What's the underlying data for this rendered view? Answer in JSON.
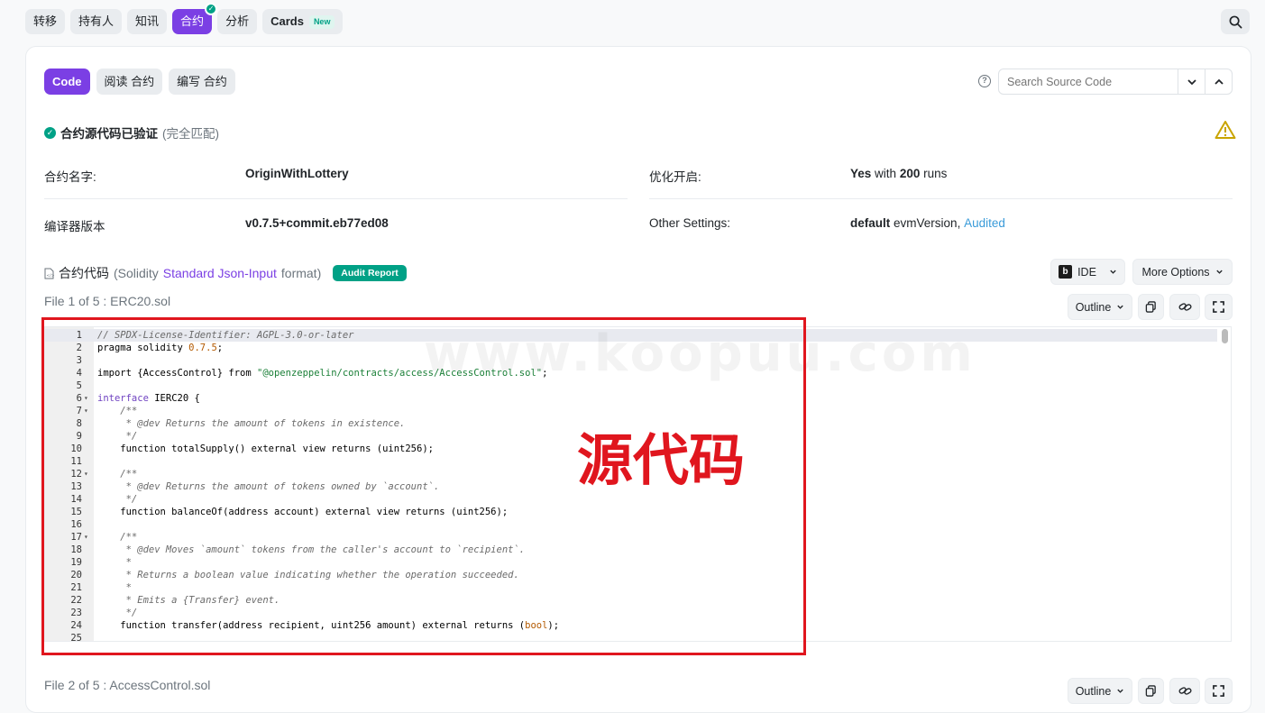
{
  "topnav": {
    "tabs": [
      {
        "label": "转移"
      },
      {
        "label": "持有人"
      },
      {
        "label": "知讯"
      },
      {
        "label": "合约",
        "active": true
      },
      {
        "label": "分析"
      },
      {
        "label": "Cards",
        "badge": "New"
      }
    ]
  },
  "subtabs": [
    {
      "label": "Code",
      "active": true
    },
    {
      "label": "阅读 合约"
    },
    {
      "label": "编写 合约"
    }
  ],
  "source_search": {
    "placeholder": "Search Source Code"
  },
  "verified": {
    "title": "合约源代码已验证",
    "note": "(完全匹配)"
  },
  "info": {
    "contract_name_label": "合约名字:",
    "contract_name": "OriginWithLottery",
    "optimization_label": "优化开启:",
    "optimization_yes": "Yes",
    "optimization_with": "with",
    "optimization_runs": "200",
    "optimization_runs_word": "runs",
    "compiler_label": "编译器版本",
    "compiler_value": "v0.7.5+commit.eb77ed08",
    "other_label": "Other Settings:",
    "other_default": "default",
    "other_evm": "evmVersion,",
    "other_audited": "Audited"
  },
  "code_section": {
    "title": "合约代码",
    "open": "(Solidity",
    "format_link": "Standard Json-Input",
    "close": "format)",
    "audit_badge": "Audit Report",
    "ide_label": "IDE",
    "ide_logo": "b",
    "more_options": "More Options",
    "outline": "Outline"
  },
  "files": [
    {
      "label": "File 1 of 5 : ERC20.sol"
    },
    {
      "label": "File 2 of 5 : AccessControl.sol"
    }
  ],
  "code_lines": [
    {
      "n": "1",
      "t": "// SPDX-License-Identifier: AGPL-3.0-or-later"
    },
    {
      "n": "2",
      "t": "pragma solidity "
    },
    {
      "n": "3",
      "t": ""
    },
    {
      "n": "4",
      "t": "import {AccessControl} from "
    },
    {
      "n": "5",
      "t": ""
    },
    {
      "n": "6",
      "t": " IERC20 {"
    },
    {
      "n": "7",
      "t": "    /**"
    },
    {
      "n": "8",
      "t": "     * @dev Returns the amount of tokens in existence."
    },
    {
      "n": "9",
      "t": "     */"
    },
    {
      "n": "10",
      "t": "    function totalSupply() external view returns (uint256);"
    },
    {
      "n": "11",
      "t": ""
    },
    {
      "n": "12",
      "t": "    /**"
    },
    {
      "n": "13",
      "t": "     * @dev Returns the amount of tokens owned by `account`."
    },
    {
      "n": "14",
      "t": "     */"
    },
    {
      "n": "15",
      "t": "    function balanceOf(address account) external view returns (uint256);"
    },
    {
      "n": "16",
      "t": ""
    },
    {
      "n": "17",
      "t": "    /**"
    },
    {
      "n": "18",
      "t": "     * @dev Moves `amount` tokens from the caller's account to `recipient`."
    },
    {
      "n": "19",
      "t": "     *"
    },
    {
      "n": "20",
      "t": "     * Returns a boolean value indicating whether the operation succeeded."
    },
    {
      "n": "21",
      "t": "     *"
    },
    {
      "n": "22",
      "t": "     * Emits a {Transfer} event."
    },
    {
      "n": "23",
      "t": "     */"
    },
    {
      "n": "24",
      "t": "    function transfer(address recipient, uint256 amount) external returns ("
    },
    {
      "n": "25",
      "t": ""
    }
  ],
  "code_tokens": {
    "version": "0.7.5",
    "semicolon": ";",
    "import_path": "\"@openzeppelin/contracts/access/AccessControl.sol\"",
    "interface_kw": "interface",
    "bool_kw": "bool",
    "close_paren": ");"
  },
  "watermark": "www.koopuu.com",
  "overlay_label": "源代码",
  "colors": {
    "accent": "#7b3fe4",
    "success": "#00a186",
    "highlight": "#e0161e",
    "link": "#3a9bd9"
  }
}
